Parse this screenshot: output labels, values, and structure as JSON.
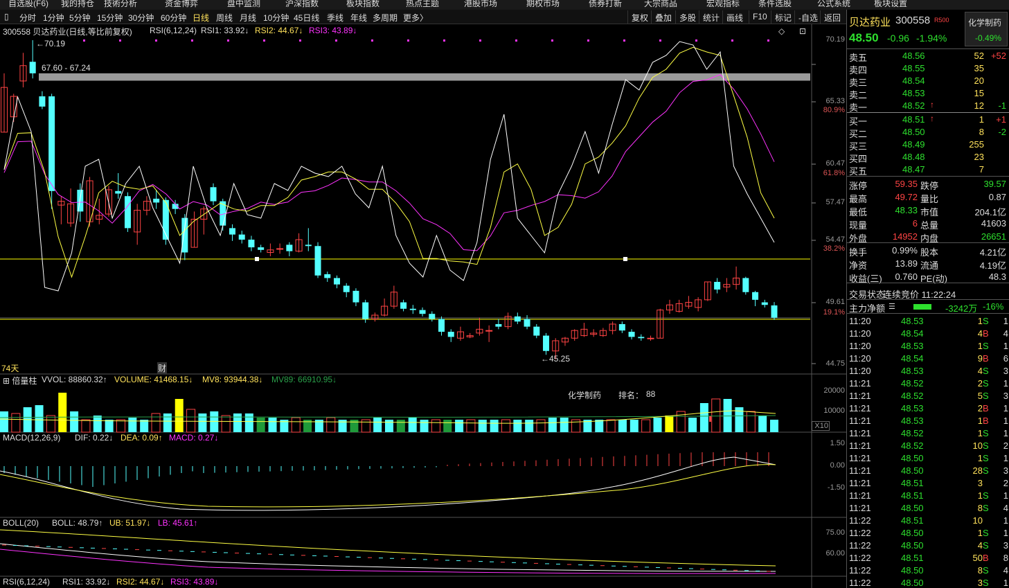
{
  "top_menu": [
    "自选股(F6)",
    "我的持仓",
    "技術分析",
    "资金博弈",
    "盘中监测",
    "沪深指数",
    "板块指数",
    "热点主题",
    "港股市场",
    "期权市场",
    "债券打新",
    "大宗商品",
    "宏观指标",
    "条件选股",
    "公式系统",
    "板块设置"
  ],
  "periods": [
    "分时",
    "1分钟",
    "5分钟",
    "15分钟",
    "30分钟",
    "60分钟",
    "日线",
    "周线",
    "月线",
    "10分钟",
    "45日线",
    "季线",
    "年线",
    "多周期",
    "更多〉"
  ],
  "active_period": "日线",
  "toolbar": [
    "复权",
    "叠加",
    "多股",
    "统计",
    "画线",
    "F10",
    "标记",
    "-自选",
    "返回"
  ],
  "main_chart": {
    "stock_title": "300558 贝达药业(日线,等比前复权)",
    "rsi_label": "RSI(6,12,24)",
    "rsi1": "RSI1: 33.92↓",
    "rsi2": "RSI2: 44.67↓",
    "rsi3": "RSI3: 43.89↓",
    "high_label": "←70.19",
    "low_label": "←45.25",
    "range_label": "67.60 - 67.24",
    "days_label": "74天",
    "cai_label": "财",
    "price_axis": [
      "70.19",
      "65.33",
      "60.47",
      "57.47",
      "54.47",
      "49.61",
      "44.75"
    ],
    "pct_axis": [
      "80.9%",
      "61.8%",
      "38.2%",
      "19.1%"
    ],
    "colors": {
      "up": "#ff4444",
      "down": "#54ffff",
      "rsi1": "#ffffff",
      "rsi2": "#ffff44",
      "rsi3": "#ff33ff",
      "support": "#ffff00",
      "band": "#999999"
    }
  },
  "volume_chart": {
    "name": "倍量柱",
    "vvol": "VVOL: 88860.32↑",
    "volume": "VOLUME: 41468.15↓",
    "mv8": "MV8: 93944.38↓",
    "mv89": "MV89: 66910.95↓",
    "axis": [
      "20000",
      "10000"
    ],
    "unit": "X10",
    "industry": "化学制药",
    "rank_label": "排名：",
    "rank": "88"
  },
  "macd_chart": {
    "label": "MACD(12,26,9)",
    "dif": "DIF: 0.22↓",
    "dea": "DEA: 0.09↑",
    "macd": "MACD: 0.27↓",
    "axis": [
      "1.50",
      "0.00",
      "-1.50"
    ]
  },
  "boll_chart": {
    "label": "BOLL(20)",
    "boll": "BOLL: 48.79↑",
    "ub": "UB: 51.97↓",
    "lb": "LB: 45.61↑",
    "axis": [
      "75.00",
      "60.00"
    ]
  },
  "rsi_bottom": {
    "label": "RSI(6,12,24)",
    "rsi1": "RSI1: 33.92↓",
    "rsi2": "RSI2: 44.67↓",
    "rsi3": "RSI3: 43.89↓"
  },
  "quote": {
    "name": "贝达药业",
    "code": "300558",
    "badge": "R500",
    "sector": "化学制药",
    "sector_pct": "-0.49%",
    "price": "48.50",
    "change": "-0.96",
    "change_pct": "-1.94%",
    "asks": [
      {
        "label": "卖五",
        "price": "48.56",
        "vol": "52",
        "chg": "+52"
      },
      {
        "label": "卖四",
        "price": "48.55",
        "vol": "35",
        "chg": ""
      },
      {
        "label": "卖三",
        "price": "48.54",
        "vol": "20",
        "chg": ""
      },
      {
        "label": "卖二",
        "price": "48.53",
        "vol": "15",
        "chg": ""
      },
      {
        "label": "卖一",
        "price": "48.52",
        "vol": "12",
        "chg": "-1"
      }
    ],
    "bids": [
      {
        "label": "买一",
        "price": "48.51",
        "vol": "1",
        "chg": "+1"
      },
      {
        "label": "买二",
        "price": "48.50",
        "vol": "8",
        "chg": "-2"
      },
      {
        "label": "买三",
        "price": "48.49",
        "vol": "255",
        "chg": ""
      },
      {
        "label": "买四",
        "price": "48.48",
        "vol": "23",
        "chg": ""
      },
      {
        "label": "买五",
        "price": "48.47",
        "vol": "7",
        "chg": ""
      }
    ],
    "stats": [
      {
        "l1": "涨停",
        "v1": "59.35",
        "l2": "跌停",
        "v2": "39.57"
      },
      {
        "l1": "最高",
        "v1": "49.72",
        "l2": "量比",
        "v2": "0.87"
      },
      {
        "l1": "最低",
        "v1": "48.33",
        "l2": "市值",
        "v2": "204.1亿"
      },
      {
        "l1": "现量",
        "v1": "6",
        "l2": "总量",
        "v2": "41603"
      },
      {
        "l1": "外盘",
        "v1": "14952",
        "l2": "内盘",
        "v2": "26651"
      }
    ],
    "stats2": [
      {
        "l1": "换手",
        "v1": "0.99%",
        "l2": "股本",
        "v2": "4.21亿"
      },
      {
        "l1": "净资",
        "v1": "13.89",
        "l2": "流通",
        "v2": "4.19亿"
      },
      {
        "l1": "收益(三)",
        "v1": "0.760",
        "l2": "PE(动)",
        "v2": "48.3"
      }
    ],
    "trade_status_label": "交易状态:",
    "trade_status": "连续竞价 11:22:24",
    "main_flow_label": "主力净额",
    "main_flow": "-3242万",
    "main_flow_pct": "-16%"
  },
  "ticks": [
    {
      "t": "11:20",
      "p": "48.53",
      "v": "1",
      "s": "S",
      "n": "1"
    },
    {
      "t": "11:20",
      "p": "48.54",
      "v": "4",
      "s": "B",
      "n": "4"
    },
    {
      "t": "11:20",
      "p": "48.53",
      "v": "1",
      "s": "S",
      "n": "1"
    },
    {
      "t": "11:20",
      "p": "48.54",
      "v": "9",
      "s": "B",
      "n": "6"
    },
    {
      "t": "11:20",
      "p": "48.53",
      "v": "4",
      "s": "S",
      "n": "3"
    },
    {
      "t": "11:21",
      "p": "48.52",
      "v": "2",
      "s": "S",
      "n": "1"
    },
    {
      "t": "11:21",
      "p": "48.52",
      "v": "5",
      "s": "S",
      "n": "3"
    },
    {
      "t": "11:21",
      "p": "48.53",
      "v": "2",
      "s": "B",
      "n": "1"
    },
    {
      "t": "11:21",
      "p": "48.53",
      "v": "1",
      "s": "B",
      "n": "1"
    },
    {
      "t": "11:21",
      "p": "48.52",
      "v": "1",
      "s": "S",
      "n": "1"
    },
    {
      "t": "11:21",
      "p": "48.52",
      "v": "10",
      "s": "S",
      "n": "2"
    },
    {
      "t": "11:21",
      "p": "48.50",
      "v": "1",
      "s": "S",
      "n": "1"
    },
    {
      "t": "11:21",
      "p": "48.50",
      "v": "28",
      "s": "S",
      "n": "3"
    },
    {
      "t": "11:21",
      "p": "48.51",
      "v": "3",
      "s": "",
      "n": "2"
    },
    {
      "t": "11:21",
      "p": "48.51",
      "v": "1",
      "s": "S",
      "n": "1"
    },
    {
      "t": "11:21",
      "p": "48.50",
      "v": "8",
      "s": "S",
      "n": "4"
    },
    {
      "t": "11:22",
      "p": "48.51",
      "v": "10",
      "s": "",
      "n": "1"
    },
    {
      "t": "11:22",
      "p": "48.50",
      "v": "1",
      "s": "S",
      "n": "1"
    },
    {
      "t": "11:22",
      "p": "48.50",
      "v": "4",
      "s": "S",
      "n": "3"
    },
    {
      "t": "11:22",
      "p": "48.51",
      "v": "50",
      "s": "B",
      "n": "8"
    },
    {
      "t": "11:22",
      "p": "48.50",
      "v": "8",
      "s": "S",
      "n": "4"
    },
    {
      "t": "11:22",
      "p": "48.50",
      "v": "3",
      "s": "S",
      "n": "1"
    }
  ],
  "candles": [
    {
      "o": 63.0,
      "c": 66.5,
      "h": 67.6,
      "l": 63.0
    },
    {
      "o": 64.2,
      "c": 65.8,
      "h": 66.0,
      "l": 63.8
    },
    {
      "o": 67.0,
      "c": 68.2,
      "h": 69.2,
      "l": 66.5
    },
    {
      "o": 68.5,
      "c": 67.6,
      "h": 70.19,
      "l": 67.2
    },
    {
      "o": 65.8,
      "c": 65.0,
      "h": 66.2,
      "l": 64.8
    },
    {
      "o": 65.8,
      "c": 58.4,
      "h": 66.0,
      "l": 57.0
    },
    {
      "o": 57.3,
      "c": 57.6,
      "h": 58.0,
      "l": 55.8
    },
    {
      "o": 55.9,
      "c": 57.4,
      "h": 58.6,
      "l": 55.6
    },
    {
      "o": 58.5,
      "c": 56.8,
      "h": 59.0,
      "l": 56.0
    },
    {
      "o": 56.0,
      "c": 59.2,
      "h": 59.5,
      "l": 55.6
    },
    {
      "o": 56.2,
      "c": 56.5,
      "h": 57.8,
      "l": 55.8
    },
    {
      "o": 56.6,
      "c": 58.5,
      "h": 58.8,
      "l": 56.4
    },
    {
      "o": 58.4,
      "c": 58.2,
      "h": 59.8,
      "l": 57.8
    },
    {
      "o": 58.0,
      "c": 55.5,
      "h": 58.3,
      "l": 55.2
    },
    {
      "o": 55.2,
      "c": 56.9,
      "h": 57.4,
      "l": 54.2
    },
    {
      "o": 56.9,
      "c": 57.6,
      "h": 58.0,
      "l": 56.5
    },
    {
      "o": 57.8,
      "c": 57.5,
      "h": 58.5,
      "l": 57.0
    },
    {
      "o": 57.7,
      "c": 54.6,
      "h": 57.9,
      "l": 54.2
    },
    {
      "o": 57.4,
      "c": 57.0,
      "h": 57.7,
      "l": 56.6
    },
    {
      "o": 56.3,
      "c": 53.6,
      "h": 56.6,
      "l": 53.0
    },
    {
      "o": 54.0,
      "c": 56.2,
      "h": 56.8,
      "l": 54.0
    },
    {
      "o": 56.2,
      "c": 57.0,
      "h": 57.2,
      "l": 55.0
    },
    {
      "o": 58.7,
      "c": 57.6,
      "h": 59.0,
      "l": 57.3
    },
    {
      "o": 57.6,
      "c": 55.7,
      "h": 57.8,
      "l": 55.3
    },
    {
      "o": 55.5,
      "c": 55.0,
      "h": 55.8,
      "l": 54.5
    },
    {
      "o": 55.0,
      "c": 54.6,
      "h": 55.3,
      "l": 54.3
    },
    {
      "o": 54.6,
      "c": 54.0,
      "h": 54.9,
      "l": 53.7
    },
    {
      "o": 54.0,
      "c": 53.8,
      "h": 54.2,
      "l": 53.6
    },
    {
      "o": 53.6,
      "c": 53.8,
      "h": 54.3,
      "l": 53.3
    },
    {
      "o": 53.9,
      "c": 53.9,
      "h": 54.3,
      "l": 53.5
    },
    {
      "o": 54.2,
      "c": 53.7,
      "h": 54.4,
      "l": 53.3
    },
    {
      "o": 53.7,
      "c": 54.6,
      "h": 55.1,
      "l": 53.6
    },
    {
      "o": 54.2,
      "c": 54.1,
      "h": 55.5,
      "l": 53.7
    },
    {
      "o": 54.1,
      "c": 51.8,
      "h": 54.4,
      "l": 51.6
    },
    {
      "o": 51.9,
      "c": 51.6,
      "h": 52.1,
      "l": 51.3
    },
    {
      "o": 51.6,
      "c": 51.1,
      "h": 51.8,
      "l": 50.8
    },
    {
      "o": 51.0,
      "c": 50.5,
      "h": 51.2,
      "l": 50.1
    },
    {
      "o": 50.6,
      "c": 49.7,
      "h": 50.8,
      "l": 49.4
    },
    {
      "o": 49.7,
      "c": 48.4,
      "h": 49.9,
      "l": 48.1
    },
    {
      "o": 48.4,
      "c": 48.7,
      "h": 48.9,
      "l": 48.2
    },
    {
      "o": 48.7,
      "c": 49.4,
      "h": 50.0,
      "l": 48.6
    },
    {
      "o": 49.4,
      "c": 50.5,
      "h": 51.0,
      "l": 49.2
    },
    {
      "o": 49.7,
      "c": 49.2,
      "h": 49.9,
      "l": 49.0
    },
    {
      "o": 49.2,
      "c": 49.1,
      "h": 49.5,
      "l": 48.8
    },
    {
      "o": 49.1,
      "c": 48.8,
      "h": 49.3,
      "l": 48.6
    },
    {
      "o": 48.8,
      "c": 48.4,
      "h": 49.0,
      "l": 48.2
    },
    {
      "o": 48.4,
      "c": 47.4,
      "h": 48.6,
      "l": 47.1
    },
    {
      "o": 47.4,
      "c": 47.0,
      "h": 47.6,
      "l": 46.6
    },
    {
      "o": 46.9,
      "c": 47.4,
      "h": 47.8,
      "l": 46.7
    },
    {
      "o": 47.0,
      "c": 47.1,
      "h": 47.3,
      "l": 46.9
    },
    {
      "o": 47.3,
      "c": 47.6,
      "h": 48.5,
      "l": 47.1
    },
    {
      "o": 47.5,
      "c": 47.5,
      "h": 47.9,
      "l": 46.6
    },
    {
      "o": 48.0,
      "c": 47.8,
      "h": 48.4,
      "l": 47.6
    },
    {
      "o": 47.8,
      "c": 48.6,
      "h": 48.9,
      "l": 47.6
    },
    {
      "o": 48.6,
      "c": 48.2,
      "h": 48.9,
      "l": 48.0
    },
    {
      "o": 48.4,
      "c": 47.8,
      "h": 48.7,
      "l": 47.6
    },
    {
      "o": 47.8,
      "c": 47.1,
      "h": 48.0,
      "l": 46.9
    },
    {
      "o": 47.1,
      "c": 45.9,
      "h": 47.3,
      "l": 45.6
    },
    {
      "o": 45.9,
      "c": 46.7,
      "h": 46.9,
      "l": 45.25
    },
    {
      "o": 46.6,
      "c": 46.9,
      "h": 47.0,
      "l": 46.3
    },
    {
      "o": 46.9,
      "c": 47.5,
      "h": 47.6,
      "l": 46.7
    },
    {
      "o": 47.1,
      "c": 47.6,
      "h": 48.1,
      "l": 47.0
    },
    {
      "o": 47.2,
      "c": 47.3,
      "h": 47.6,
      "l": 47.0
    },
    {
      "o": 47.1,
      "c": 47.5,
      "h": 47.7,
      "l": 47.0
    },
    {
      "o": 47.5,
      "c": 48.0,
      "h": 48.2,
      "l": 47.2
    },
    {
      "o": 48.0,
      "c": 47.5,
      "h": 48.2,
      "l": 47.3
    },
    {
      "o": 47.4,
      "c": 47.0,
      "h": 47.6,
      "l": 46.8
    },
    {
      "o": 47.0,
      "c": 46.9,
      "h": 47.2,
      "l": 46.7
    },
    {
      "o": 46.9,
      "c": 46.9,
      "h": 47.1,
      "l": 46.7
    },
    {
      "o": 46.9,
      "c": 49.1,
      "h": 49.2,
      "l": 46.9
    },
    {
      "o": 49.1,
      "c": 49.5,
      "h": 49.9,
      "l": 48.8
    },
    {
      "o": 49.0,
      "c": 49.6,
      "h": 49.9,
      "l": 48.9
    },
    {
      "o": 49.4,
      "c": 49.7,
      "h": 50.2,
      "l": 49.2
    },
    {
      "o": 49.3,
      "c": 49.9,
      "h": 50.1,
      "l": 49.0
    },
    {
      "o": 49.9,
      "c": 51.3,
      "h": 51.3,
      "l": 49.8
    },
    {
      "o": 51.3,
      "c": 50.7,
      "h": 51.6,
      "l": 50.4
    },
    {
      "o": 50.9,
      "c": 51.1,
      "h": 51.6,
      "l": 50.5
    },
    {
      "o": 51.1,
      "c": 51.6,
      "h": 52.5,
      "l": 50.7
    },
    {
      "o": 51.6,
      "c": 50.5,
      "h": 51.7,
      "l": 50.3
    },
    {
      "o": 50.5,
      "c": 49.9,
      "h": 50.6,
      "l": 49.4
    },
    {
      "o": 49.7,
      "c": 49.5,
      "h": 49.9,
      "l": 49.3
    },
    {
      "o": 49.46,
      "c": 48.5,
      "h": 49.72,
      "l": 48.33
    }
  ],
  "rsi1_series": [
    59,
    80,
    70,
    25,
    24,
    35,
    60,
    62,
    45,
    55,
    60,
    48,
    40,
    32,
    60,
    48,
    40,
    55,
    46,
    45,
    55,
    53,
    60,
    58,
    57,
    60,
    52,
    48,
    60,
    40,
    32,
    28,
    40,
    30,
    27,
    38,
    62,
    75,
    45,
    40,
    35,
    52,
    60,
    70,
    58,
    72,
    85,
    82,
    90,
    92,
    96,
    95,
    88,
    93,
    60,
    52,
    45,
    38
  ],
  "vol_bars": [
    50,
    45,
    60,
    65,
    40,
    95,
    50,
    30,
    40,
    30,
    30,
    35,
    30,
    45,
    45,
    80,
    55,
    45,
    50,
    40,
    45,
    45,
    35,
    35,
    30,
    35,
    30,
    30,
    35,
    30,
    30,
    30,
    35,
    30,
    30,
    35,
    30,
    30,
    30,
    30,
    30,
    30,
    30,
    30,
    30,
    30,
    30,
    35,
    35,
    30,
    30,
    30,
    30,
    30,
    30,
    30,
    35,
    40,
    50,
    35,
    70,
    80,
    80,
    60,
    50,
    40,
    30
  ]
}
